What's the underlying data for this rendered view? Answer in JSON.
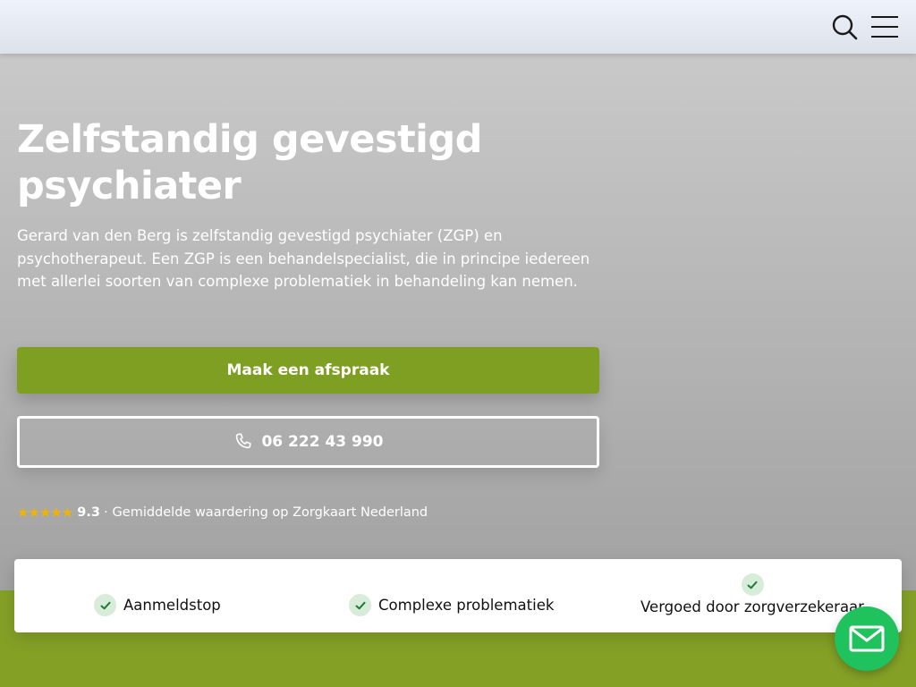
{
  "hero": {
    "title_line1": "Zelfstandig gevestigd",
    "title_line2": "psychiater",
    "description": "Gerard van den Berg is zelfstandig gevestigd psychiater (ZGP) en psychotherapeut. Een ZGP is een behandelspecialist, die in principe iedereen met allerlei soorten van complexe problematiek in behandeling kan nemen.",
    "cta_label": "Maak een afspraak",
    "phone_label": "06 222 43 990"
  },
  "rating": {
    "stars": "★★★★★",
    "score": "9.3",
    "separator": "·",
    "text": "Gemiddelde waardering op Zorgkaart Nederland"
  },
  "features": [
    {
      "label": "Aanmeldstop"
    },
    {
      "label": "Complexe problematiek"
    },
    {
      "label": "Vergoed door zorgverzekeraar"
    }
  ],
  "icons": {
    "search": "search-icon",
    "menu": "menu-icon",
    "phone": "phone-icon",
    "check": "check-icon",
    "mail": "mail-icon"
  },
  "colors": {
    "brand_green": "#7f9f22",
    "page_green": "#84a126",
    "fab_green": "#1fc25c",
    "star": "#f2b300",
    "check_bg": "#d7ecd9"
  }
}
